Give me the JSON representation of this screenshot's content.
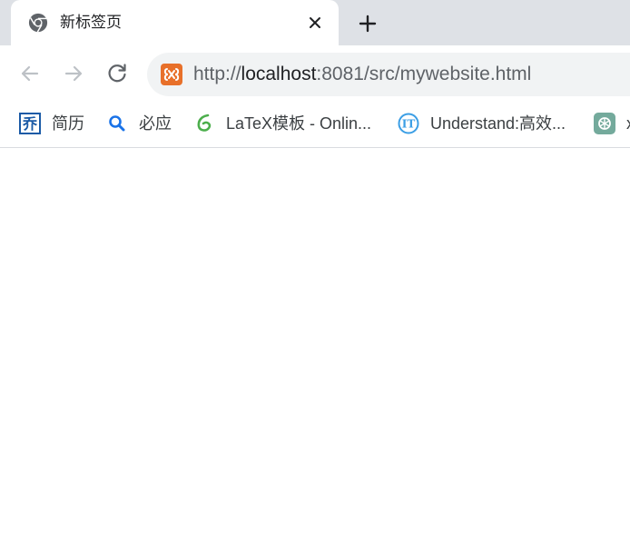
{
  "tab": {
    "title": "新标签页",
    "close_icon": "close-icon"
  },
  "new_tab_icon": "plus-icon",
  "toolbar": {
    "back_icon": "arrow-left-icon",
    "forward_icon": "arrow-right-icon",
    "reload_icon": "reload-icon"
  },
  "omnibox": {
    "scheme": "http://",
    "host": "localhost",
    "rest": ":8081/src/mywebsite.html",
    "site_icon": "xampp-icon"
  },
  "bookmarks": [
    {
      "label": "简历",
      "icon": "resume-icon"
    },
    {
      "label": "必应",
      "icon": "search-icon"
    },
    {
      "label": "LaTeX模板 - Onlin...",
      "icon": "overleaf-icon"
    },
    {
      "label": "Understand:高效...",
      "icon": "it-icon"
    },
    {
      "label": "x",
      "icon": "chatgpt-icon"
    }
  ],
  "colors": {
    "tab_strip": "#dee1e6",
    "omnibox_bg": "#f1f3f4",
    "accent_orange": "#e8702a",
    "bing_blue": "#1a73e8",
    "overleaf_green": "#4cae4c",
    "it_blue": "#3b9ee5",
    "chatgpt_teal": "#74aa9c"
  }
}
